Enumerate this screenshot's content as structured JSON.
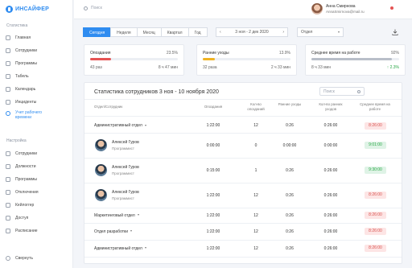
{
  "app": {
    "logo_text": "ИНСАЙФЕР"
  },
  "sidebar": {
    "section_stats": "Статистика",
    "stats_items": [
      {
        "label": "Главная",
        "icon": "home-icon"
      },
      {
        "label": "Сотрудники",
        "icon": "users-icon"
      },
      {
        "label": "Программы",
        "icon": "apps-icon"
      },
      {
        "label": "Табель",
        "icon": "timesheet-icon"
      },
      {
        "label": "Календарь",
        "icon": "calendar-icon"
      },
      {
        "label": "Инциденты",
        "icon": "incident-icon"
      },
      {
        "label": "Учет рабочего времени",
        "icon": "clock-icon",
        "active": true
      }
    ],
    "section_settings": "Настройка",
    "settings_items": [
      {
        "label": "Сотрудники",
        "icon": "users-icon"
      },
      {
        "label": "Должности",
        "icon": "position-icon"
      },
      {
        "label": "Программы",
        "icon": "apps-icon"
      },
      {
        "label": "Отключения",
        "icon": "off-icon"
      },
      {
        "label": "Кейлоггер",
        "icon": "keyboard-icon"
      },
      {
        "label": "Доступ",
        "icon": "lock-icon"
      },
      {
        "label": "Расписание",
        "icon": "schedule-icon"
      }
    ],
    "collapse_label": "Свернуть"
  },
  "topbar": {
    "search_placeholder": "Поиск",
    "user_name": "Анна Смирнова",
    "user_email": "AnnaSmirnova@mail.ru"
  },
  "filters": {
    "periods": [
      "Сегодня",
      "Неделя",
      "Месяц",
      "Квартал",
      "Год"
    ],
    "active_period": "Сегодня",
    "date_range": "3 ноя - 2 дек 2020",
    "department": "Отдел"
  },
  "cards": [
    {
      "title": "Опоздания",
      "percent": "23.5%",
      "fill": 0.235,
      "color": "#e55353",
      "left": "43 раз",
      "right": "8 ч 47 мин"
    },
    {
      "title": "Ранние уходы",
      "percent": "13.9%",
      "fill": 0.139,
      "color": "#f0b323",
      "left": "32 раза",
      "right": "2 ч 33 мин"
    },
    {
      "title": "Среднее время на работе",
      "percent": "92%",
      "fill": 0.92,
      "color": "#b9bfc9",
      "left": "8 ч 33 мин",
      "right_change": "↑ 2.3%"
    }
  ],
  "table": {
    "title": "Статистика сотрудников 3 ноя - 10 ноября 2020",
    "search_placeholder": "Поиск",
    "headers": {
      "employee": "Отдел/Сотрудник",
      "late": "Опоздания",
      "late_count": "Кол-во опозданий",
      "early": "Ранние уходы",
      "early_count": "Кол-во ранних уходов",
      "avg": "Среднее время на работе"
    },
    "rows": [
      {
        "type": "dept",
        "name": "Административный отдел",
        "late": "1:22:00",
        "late_count": "12",
        "early": "0:26",
        "early_count": "0:26:00",
        "avg": "8:26:00",
        "avg_color": "red"
      },
      {
        "type": "emp",
        "name": "Алексей Гуров",
        "role": "Программист",
        "late": "0:00:00",
        "late_count": "0",
        "early": "0:00:00",
        "early_count": "0:00:00",
        "avg": "9:01:00",
        "avg_color": "green"
      },
      {
        "type": "emp",
        "name": "Алексей Гуров",
        "role": "Программист",
        "late": "0:15:00",
        "late_count": "1",
        "early": "0:26",
        "early_count": "0:26:00",
        "avg": "9:30:00",
        "avg_color": "green"
      },
      {
        "type": "emp",
        "name": "Алексей Гуров",
        "role": "Программист",
        "late": "1:22:00",
        "late_count": "12",
        "early": "0:26",
        "early_count": "0:26:00",
        "avg": "8:26:00",
        "avg_color": "red"
      },
      {
        "type": "dept",
        "name": "Маркетинговый отдел",
        "late": "1:22:00",
        "late_count": "12",
        "early": "0:26",
        "early_count": "0:26:00",
        "avg": "8:26:00",
        "avg_color": "red"
      },
      {
        "type": "dept",
        "name": "Отдел разработки",
        "late": "1:22:00",
        "late_count": "12",
        "early": "0:26",
        "early_count": "0:26:00",
        "avg": "8:26:00",
        "avg_color": "red"
      },
      {
        "type": "dept",
        "name": "Административный отдел",
        "late": "1:22:00",
        "late_count": "12",
        "early": "0:26",
        "early_count": "0:26:00",
        "avg": "8:26:00",
        "avg_color": "red"
      }
    ]
  }
}
